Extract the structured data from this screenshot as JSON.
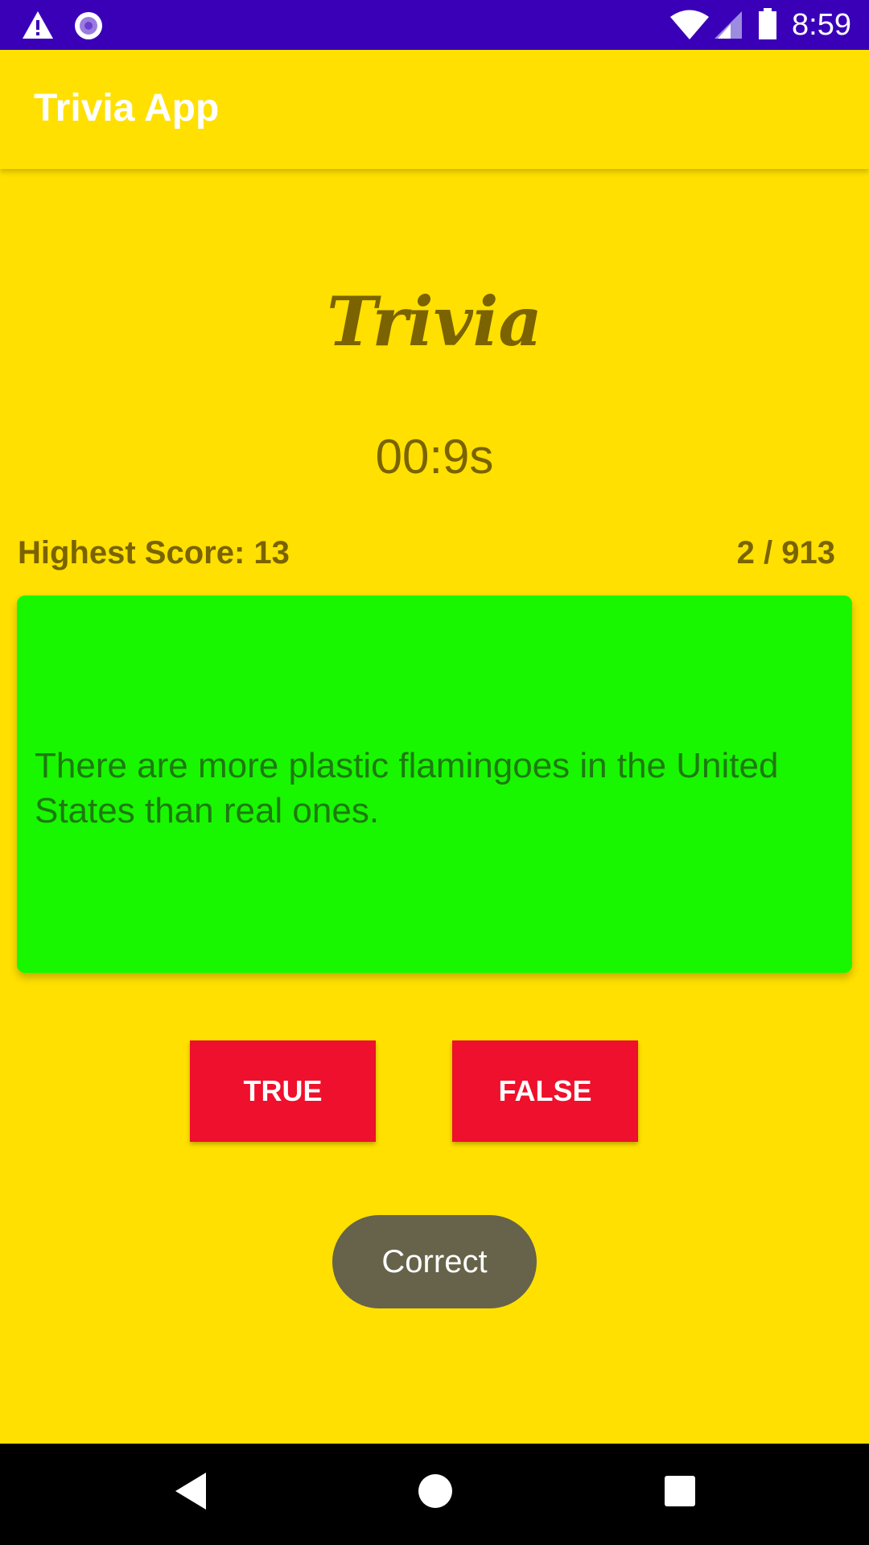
{
  "status_bar": {
    "time": "8:59",
    "icons": [
      "warning-icon",
      "circle-notification-icon",
      "wifi-icon",
      "signal-icon",
      "battery-icon"
    ]
  },
  "app_bar": {
    "title": "Trivia App"
  },
  "main": {
    "heading": "Trivia",
    "timer": "00:9s",
    "highest_score": "Highest Score: 13",
    "progress": "2 / 913",
    "question": "There are more plastic flamingoes in the United States than real ones.",
    "true_label": "TRUE",
    "false_label": "FALSE"
  },
  "toast": {
    "message": "Correct"
  },
  "nav_bar": {
    "icons": [
      "back-icon",
      "home-icon",
      "recents-icon"
    ]
  },
  "colors": {
    "status_bar": "#3A00B8",
    "background": "#FFE000",
    "card": "#18F700",
    "button": "#EE102C",
    "text_dark": "#7A6300",
    "toast": "#66634A"
  }
}
